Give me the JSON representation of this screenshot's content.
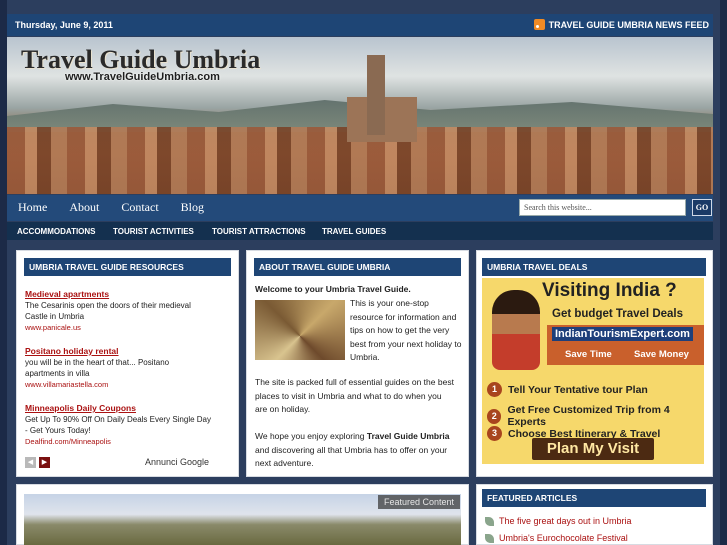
{
  "topbar": {
    "date": "Thursday, June 9, 2011",
    "rss_label": "TRAVEL GUIDE UMBRIA NEWS FEED"
  },
  "header": {
    "title": "Travel Guide Umbria",
    "url": "www.TravelGuideUmbria.com"
  },
  "nav": {
    "links": [
      "Home",
      "About",
      "Contact",
      "Blog"
    ],
    "search_placeholder": "Search this website...",
    "go_label": "GO"
  },
  "subnav": [
    "ACCOMMODATIONS",
    "TOURIST ACTIVITIES",
    "TOURIST ATTRACTIONS",
    "TRAVEL GUIDES"
  ],
  "resources": {
    "title": "UMBRIA TRAVEL GUIDE RESOURCES",
    "items": [
      {
        "heading": "Medieval apartments",
        "text": "The Cesarinis open the doors of their medieval Castle in Umbria",
        "url": "www.panicale.us"
      },
      {
        "heading": "Positano holiday rental",
        "text": "you will be in the heart of that... Positano apartments in villa",
        "url": "www.villamariastella.com"
      },
      {
        "heading": "Minneapolis Daily Coupons",
        "text": "Get Up To 90% Off On Daily Deals Every Single Day - Get Yours Today!",
        "url": "Dealfind.com/Minneapolis"
      }
    ],
    "ads_by": "Annunci Google"
  },
  "about": {
    "title": "ABOUT TRAVEL GUIDE UMBRIA",
    "welcome": "Welcome to your Umbria Travel Guide.",
    "intro": "This is your one-stop resource for information and tips on how to get the very best from your next holiday to Umbria.",
    "p2": "The site is packed full of essential guides on the best places to visit in Umbria and what to do when you are on holiday.",
    "p3_a": "We hope you enjoy exploring ",
    "p3_b": "Travel Guide Umbria",
    "p3_c": " and discovering all that Umbria has to offer on your next adventure."
  },
  "deals": {
    "title": "UMBRIA TRAVEL DEALS",
    "heading": "Visiting India ?",
    "sub": "Get budget Travel Deals",
    "brand": "IndianTourismExpert.com",
    "save_time": "Save Time",
    "save_money": "Save Money",
    "steps": [
      "Tell Your Tentative tour Plan",
      "Get Free Customized Trip from 4 Experts",
      "Choose Best Itinerary & Travel"
    ],
    "cta": "Plan My Visit"
  },
  "featured_content": {
    "tag": "Featured Content"
  },
  "featured_articles": {
    "title": "FEATURED ARTICLES",
    "items": [
      "The five great days out in Umbria",
      "Umbria's Eurochocolate Festival"
    ]
  }
}
